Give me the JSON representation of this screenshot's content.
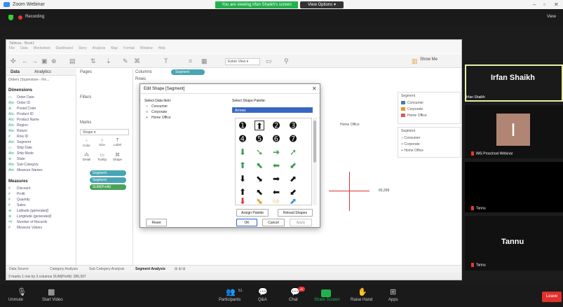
{
  "zoom": {
    "window_title": "Zoom Webinar",
    "viewing_banner": "You are viewing Irfan Shaikh's screen",
    "view_options": "View Options",
    "recording": "Recording",
    "view_menu": "View"
  },
  "tableau": {
    "title": "Tableau - Book1",
    "menu": [
      "File",
      "Data",
      "Worksheet",
      "Dashboard",
      "Story",
      "Analysis",
      "Map",
      "Format",
      "Window",
      "Help"
    ],
    "entire_view": "Entire View",
    "show_me": "Show Me",
    "tabs": {
      "data": "Data",
      "analytics": "Analytics",
      "pages": "Pages"
    },
    "source": "Orders (Superstore - Fin...",
    "dimensions_title": "Dimensions",
    "dimensions": [
      "Order Date",
      "Order ID",
      "Postal Code",
      "Product ID",
      "Product Name",
      "Region",
      "Return",
      "Row ID",
      "Segment",
      "Ship Date",
      "Ship Mode",
      "State",
      "Sub-Category",
      "Measure Names"
    ],
    "measures_title": "Measures",
    "measures": [
      "Discount",
      "Profit",
      "Quantity",
      "Sales",
      "Latitude (generated)",
      "Longitude (generated)",
      "Number of Records",
      "Measure Values"
    ],
    "filters": "Filters",
    "marks": "Marks",
    "mark_type": "Shape",
    "mark_buttons": [
      "Color",
      "Size",
      "Label",
      "Detail",
      "Tooltip",
      "Shape"
    ],
    "mark_pills": [
      "Segment",
      "Segment",
      "SUM(Profit)"
    ],
    "columns_label": "Columns",
    "columns_pill": "Segment",
    "rows_label": "Rows",
    "sheet_header_short": "Se",
    "home_office_header": "Home Office",
    "value_label": "60,299",
    "legend_color": {
      "title": "Segment",
      "items": [
        "Consumer",
        "Corporate",
        "Home Office"
      ],
      "colors": [
        "#4e79a7",
        "#f28e2b",
        "#e15759"
      ]
    },
    "legend_shape": {
      "title": "Segment",
      "items": [
        "Consumer",
        "Corporate",
        "Home Office"
      ]
    },
    "sheet_tabs": [
      "Data Source",
      "Category Analysis",
      "Sub Category Analysis",
      "Segment Analysis"
    ],
    "status": "3 marks   1 row by 3 columns   SUM(Profit): 286,397"
  },
  "dialog": {
    "title": "Edit Shape [Segment]",
    "select_data_item": "Select Data Item:",
    "data_items": [
      "Consumer",
      "Corporate",
      "Home Office"
    ],
    "select_palette": "Select Shape Palette:",
    "palette_value": "Arrows",
    "assign_palette": "Assign Palette",
    "reload_shapes": "Reload Shapes",
    "reset": "Reset",
    "ok": "OK",
    "cancel": "Cancel",
    "apply": "Apply"
  },
  "participants": {
    "irfan_big": "Irfan Shaikh",
    "irfan_small": "Irfan Shaikh",
    "ims_initial": "I",
    "ims_name": "IMS Proschool Webinar",
    "tannu_small_1": "Tannu",
    "tannu_big": "Tannu",
    "tannu_small_2": "Tannu"
  },
  "toolbar": {
    "unmute": "Unmute",
    "start_video": "Start Video",
    "participants": "Participants",
    "participants_count": "51",
    "qa": "Q&A",
    "chat": "Chat",
    "chat_badge": "49",
    "share_screen": "Share Screen",
    "raise_hand": "Raise Hand",
    "apps": "Apps",
    "leave": "Leave"
  }
}
